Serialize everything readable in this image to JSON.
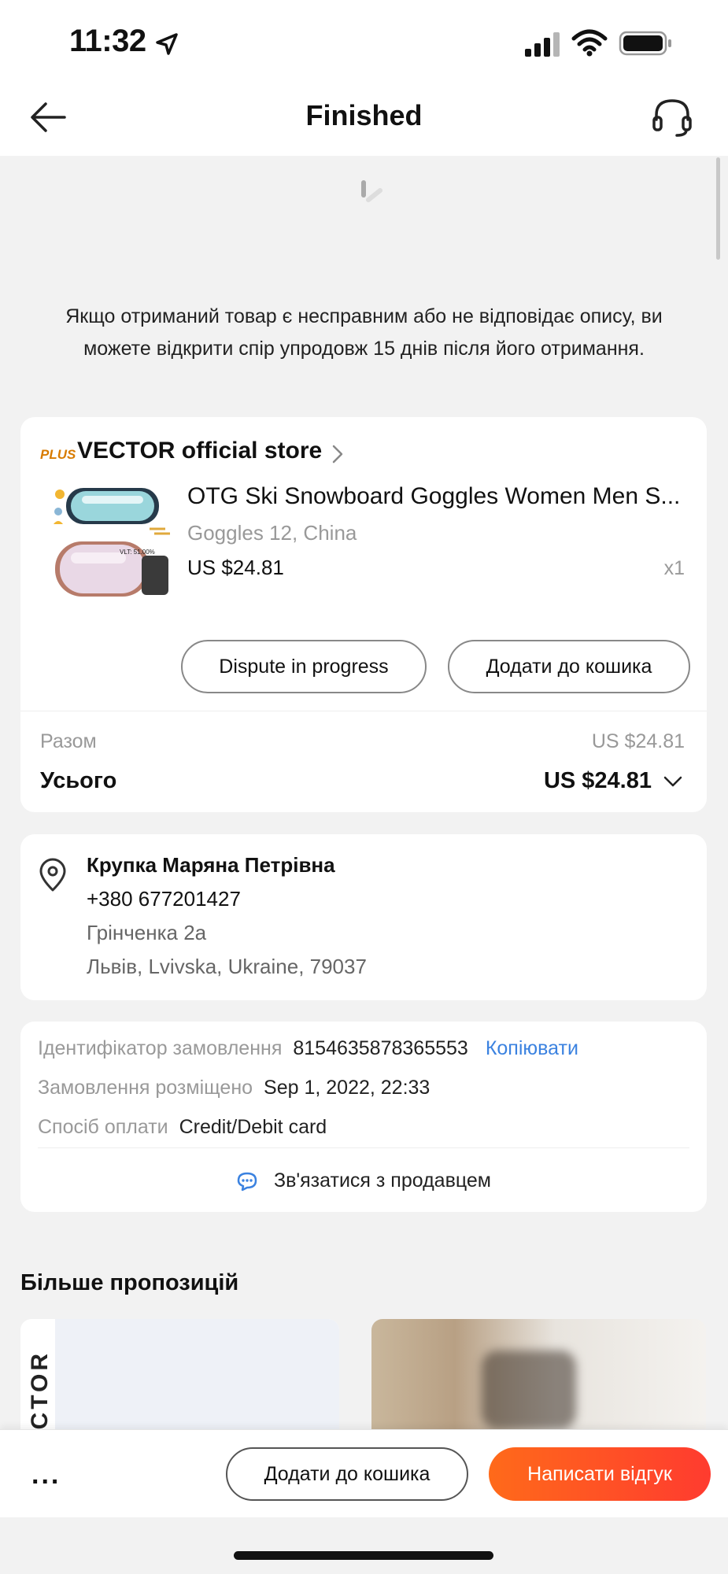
{
  "status_bar": {
    "time": "11:32"
  },
  "header": {
    "title": "Finished"
  },
  "notice": "Якщо отриманий товар є несправним або не відповідає опису, ви можете відкрити спір упродовж 15 днів після його отримання.",
  "order": {
    "store_badge": "PLUS",
    "store_name": "VECTOR official store",
    "product_title": "OTG Ski Snowboard Goggles Women Men S...",
    "product_variant": "Goggles 12, China",
    "product_price": "US $24.81",
    "product_qty": "x1",
    "dispute_label": "Dispute in progress",
    "add_to_cart_label": "Додати до кошика",
    "subtotal_label": "Разом",
    "subtotal_value": "US $24.81",
    "total_label": "Усього",
    "total_value": "US $24.81",
    "image_text": "VLT: 51.00%"
  },
  "address": {
    "name": "Крупка Маряна Петрівна",
    "phone": "+380 677201427",
    "street": "Грінченка 2а",
    "city": "Львів, Lvivska, Ukraine, 79037"
  },
  "order_info": {
    "id_label": "Ідентифікатор замовлення",
    "id_value": "8154635878365553",
    "copy_label": "Копіювати",
    "placed_label": "Замовлення розміщено",
    "placed_value": "Sep 1, 2022, 22:33",
    "payment_label": "Спосіб оплати",
    "payment_value": "Credit/Debit card",
    "contact_label": "Зв'язатися з продавцем"
  },
  "more_offers": {
    "title": "Більше пропозицій",
    "left_card_text": "ECTOR"
  },
  "bottom_bar": {
    "more_label": "...",
    "add_to_cart_label": "Додати до кошика",
    "review_label": "Написати відгук"
  },
  "colors": {
    "accent_orange": "#ff4f20",
    "link_blue": "#3b82e0",
    "plus_badge": "#d87b00"
  },
  "icons": [
    "location-arrow-icon",
    "signal-icon",
    "wifi-icon",
    "battery-icon",
    "back-arrow-icon",
    "headset-icon",
    "loading-spinner-icon",
    "chevron-right-icon",
    "chevron-down-icon",
    "location-pin-icon",
    "chat-bubble-icon"
  ]
}
